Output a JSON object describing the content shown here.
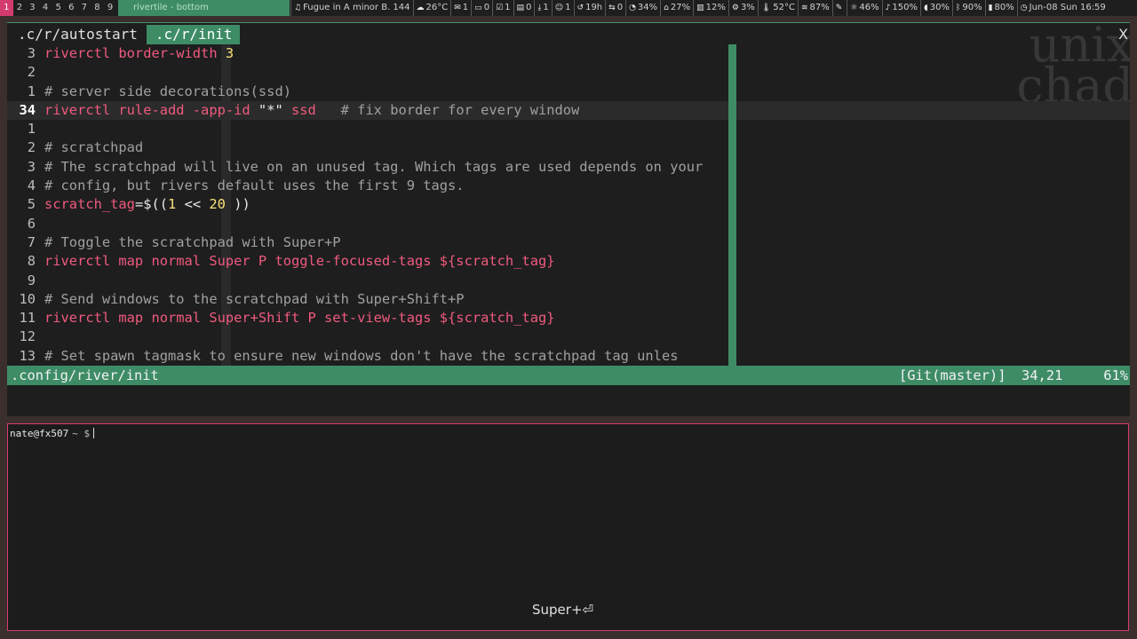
{
  "topbar": {
    "tags": [
      "1",
      "2",
      "3",
      "4",
      "5",
      "6",
      "7",
      "8",
      "9"
    ],
    "active_tag": 0,
    "layout_title": "rivertile - bottom",
    "modules": [
      {
        "icon": "music-icon",
        "glyph": "♫",
        "text": "Fugue in A minor B. 144"
      },
      {
        "icon": "weather-icon",
        "glyph": "☁",
        "text": "26°C"
      },
      {
        "icon": "mail-icon",
        "glyph": "✉",
        "text": "1"
      },
      {
        "icon": "chat-icon",
        "glyph": "▭",
        "text": "0"
      },
      {
        "icon": "todo-icon",
        "glyph": "☑",
        "text": "1"
      },
      {
        "icon": "calendar-icon",
        "glyph": "▤",
        "text": "0"
      },
      {
        "icon": "download-icon",
        "glyph": "⤓",
        "text": "1"
      },
      {
        "icon": "user-icon",
        "glyph": "☺",
        "text": "1"
      },
      {
        "icon": "uptime-icon",
        "glyph": "↺",
        "text": "19h"
      },
      {
        "icon": "network-icon",
        "glyph": "⇆",
        "text": "0"
      },
      {
        "icon": "cpu-icon",
        "glyph": "◔",
        "text": "34%"
      },
      {
        "icon": "home-icon",
        "glyph": "⌂",
        "text": "27%"
      },
      {
        "icon": "memory-icon",
        "glyph": "▥",
        "text": "12%"
      },
      {
        "icon": "gear-icon",
        "glyph": "⚙",
        "text": "3%"
      },
      {
        "icon": "temperature-icon",
        "glyph": "🌡",
        "text": "52°C"
      },
      {
        "icon": "wifi-icon",
        "glyph": "≋",
        "text": "87%"
      },
      {
        "icon": "pen-icon",
        "glyph": "✎",
        "text": ""
      },
      {
        "icon": "brightness-icon",
        "glyph": "☼",
        "text": "46%"
      },
      {
        "icon": "volume-icon",
        "glyph": "♪",
        "text": "150%"
      },
      {
        "icon": "mic-icon",
        "glyph": "◖",
        "text": "30%"
      },
      {
        "icon": "bluetooth-icon",
        "glyph": "ᛒ",
        "text": "90%"
      },
      {
        "icon": "battery-icon",
        "glyph": "▮",
        "text": "80%"
      },
      {
        "icon": "clock-icon",
        "glyph": "◷",
        "text": "Jun-08 Sun 16:59"
      }
    ]
  },
  "editor": {
    "tabs": [
      {
        "label": ".c/r/autostart",
        "active": false
      },
      {
        "label": ".c/r/init",
        "active": true
      }
    ],
    "close_glyph": "X",
    "watermark": "unix\nchad",
    "lines": [
      {
        "num": "3",
        "current": false,
        "spans": [
          {
            "t": "riverctl border-width ",
            "c": "k"
          },
          {
            "t": "3",
            "c": "n"
          }
        ]
      },
      {
        "num": "2",
        "current": false,
        "spans": []
      },
      {
        "num": "1",
        "current": false,
        "spans": [
          {
            "t": "# server side decorations(ssd)",
            "c": "c"
          }
        ]
      },
      {
        "num": "34",
        "current": true,
        "spans": [
          {
            "t": "riverctl rule-add -app-id ",
            "c": "k"
          },
          {
            "t": "\"*\"",
            "c": "s"
          },
          {
            "t": " ssd   ",
            "c": "k"
          },
          {
            "t": "# fix border for every window",
            "c": "c"
          }
        ]
      },
      {
        "num": "1",
        "current": false,
        "spans": []
      },
      {
        "num": "2",
        "current": false,
        "spans": [
          {
            "t": "# scratchpad",
            "c": "c"
          }
        ]
      },
      {
        "num": "3",
        "current": false,
        "spans": [
          {
            "t": "# The scratchpad will live on an unused tag. Which tags are used depends on your",
            "c": "c"
          }
        ]
      },
      {
        "num": "4",
        "current": false,
        "spans": [
          {
            "t": "# config, but rivers default uses the first 9 tags.",
            "c": "c"
          }
        ]
      },
      {
        "num": "5",
        "current": false,
        "spans": [
          {
            "t": "scratch_tag",
            "c": "k"
          },
          {
            "t": "=$((",
            "c": "s"
          },
          {
            "t": "1",
            "c": "n"
          },
          {
            "t": " << ",
            "c": "s"
          },
          {
            "t": "20",
            "c": "n"
          },
          {
            "t": " ))",
            "c": "s"
          }
        ]
      },
      {
        "num": "6",
        "current": false,
        "spans": []
      },
      {
        "num": "7",
        "current": false,
        "spans": [
          {
            "t": "# Toggle the scratchpad with Super+P",
            "c": "c"
          }
        ]
      },
      {
        "num": "8",
        "current": false,
        "spans": [
          {
            "t": "riverctl map normal Super P toggle-focused-tags ${scratch_tag}",
            "c": "k"
          }
        ]
      },
      {
        "num": "9",
        "current": false,
        "spans": []
      },
      {
        "num": "10",
        "current": false,
        "spans": [
          {
            "t": "# Send windows to the scratchpad with Super+Shift+P",
            "c": "c"
          }
        ]
      },
      {
        "num": "11",
        "current": false,
        "spans": [
          {
            "t": "riverctl map normal Super+Shift P set-view-tags ${scratch_tag}",
            "c": "k"
          }
        ]
      },
      {
        "num": "12",
        "current": false,
        "spans": []
      },
      {
        "num": "13",
        "current": false,
        "spans": [
          {
            "t": "# Set spawn tagmask to ensure new windows don't have the scratchpad tag unles",
            "c": "c"
          }
        ]
      }
    ],
    "status": {
      "file": ".config/river/init",
      "git": "[Git(master)]",
      "position": "34,21",
      "percent": "61%"
    }
  },
  "terminal": {
    "prompt_user": "nate@fx507",
    "prompt_tail": "~ $",
    "key_hint": "Super+⏎"
  }
}
